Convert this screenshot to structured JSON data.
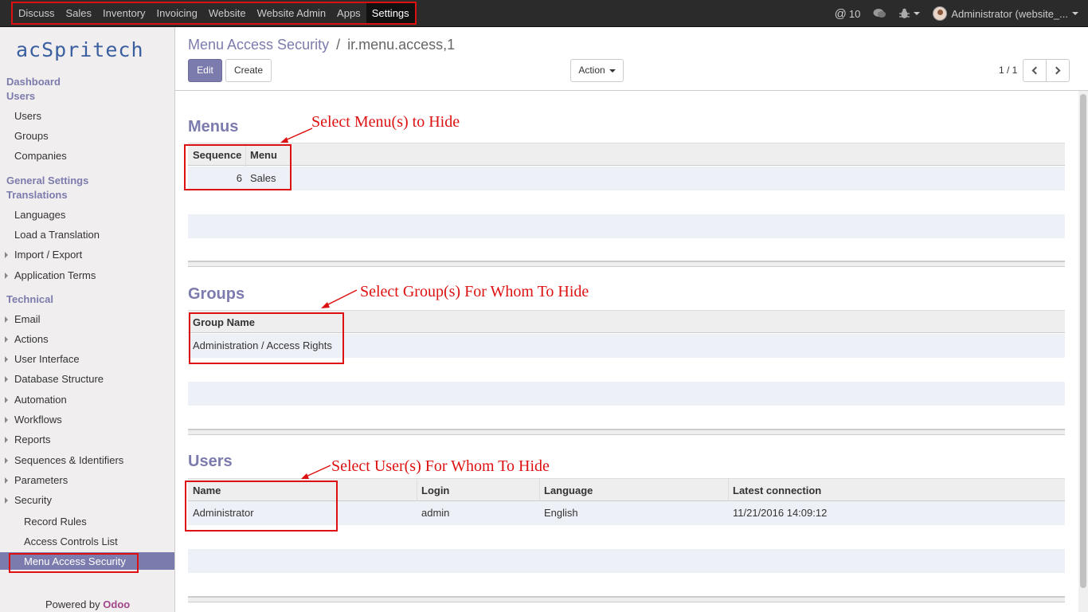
{
  "topbar": {
    "menus": [
      "Discuss",
      "Sales",
      "Inventory",
      "Invoicing",
      "Website",
      "Website Admin",
      "Apps",
      "Settings"
    ],
    "active_menu": "Settings",
    "mentions": "10",
    "user": "Administrator (website_..."
  },
  "sidebar": {
    "logo": "acSpritech",
    "dashboard": "Dashboard",
    "users_sec": "Users",
    "users": "Users",
    "groups": "Groups",
    "companies": "Companies",
    "general_settings": "General Settings",
    "translations": "Translations",
    "languages": "Languages",
    "load_translation": "Load a Translation",
    "import_export": "Import / Export",
    "app_terms": "Application Terms",
    "technical": "Technical",
    "email": "Email",
    "actions": "Actions",
    "user_interface": "User Interface",
    "db_structure": "Database Structure",
    "automation": "Automation",
    "workflows": "Workflows",
    "reports": "Reports",
    "sequences": "Sequences & Identifiers",
    "parameters": "Parameters",
    "security": "Security",
    "record_rules": "Record Rules",
    "acl": "Access Controls List",
    "menu_access": "Menu Access Security",
    "powered_by": "Powered by",
    "odoo": "Odoo"
  },
  "control_panel": {
    "breadcrumb_parent": "Menu Access Security",
    "breadcrumb_sep": "/",
    "breadcrumb_current": "ir.menu.access,1",
    "edit": "Edit",
    "create": "Create",
    "action": "Action",
    "pager": "1 / 1"
  },
  "menus_section": {
    "title": "Menus",
    "col_sequence": "Sequence",
    "col_menu": "Menu",
    "row_sequence": "6",
    "row_menu": "Sales",
    "annotation": "Select Menu(s) to Hide"
  },
  "groups_section": {
    "title": "Groups",
    "col_group": "Group Name",
    "row_group": "Administration / Access Rights",
    "annotation": "Select Group(s) For Whom To Hide"
  },
  "users_section": {
    "title": "Users",
    "col_name": "Name",
    "col_login": "Login",
    "col_language": "Language",
    "col_latest": "Latest connection",
    "row_name": "Administrator",
    "row_login": "admin",
    "row_language": "English",
    "row_latest": "11/21/2016 14:09:12",
    "annotation": "Select User(s) For Whom To Hide"
  },
  "colors": {
    "accent": "#7c7bad",
    "annotation": "#dd1111",
    "topbar": "#2b2b2b"
  }
}
